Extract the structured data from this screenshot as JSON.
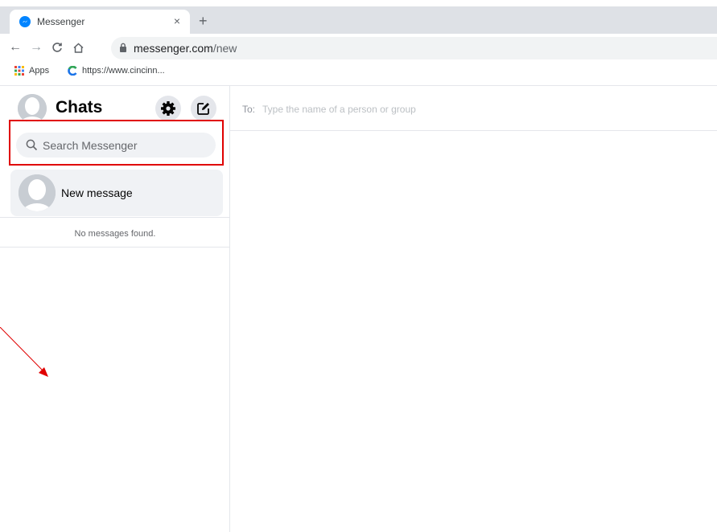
{
  "browser": {
    "tab": {
      "title": "Messenger",
      "close_glyph": "×",
      "icon": "messenger-icon"
    },
    "new_tab_glyph": "+",
    "nav": {
      "back_glyph": "←",
      "forward_glyph": "→",
      "reload_glyph": "C",
      "home_glyph": "⌂"
    },
    "address": {
      "host": "messenger.com",
      "path": "/new"
    },
    "bookmarks": [
      {
        "label": "Apps",
        "icon": "apps-grid-icon"
      },
      {
        "label": "https://www.cincinn...",
        "icon": "c-logo-icon"
      }
    ]
  },
  "sidebar": {
    "title": "Chats",
    "search_placeholder": "Search Messenger",
    "new_message_label": "New message",
    "empty_text": "No messages found."
  },
  "compose": {
    "to_label": "To:",
    "to_placeholder": "Type the name of a person or group"
  },
  "colors": {
    "highlight_box": "#e00000",
    "annotation_arrow": "#e00000",
    "messenger_blue": "#0084ff"
  }
}
